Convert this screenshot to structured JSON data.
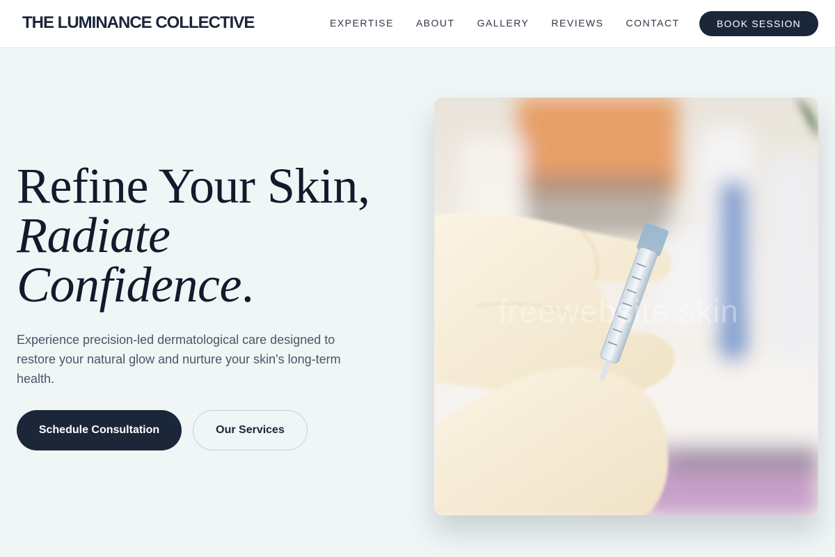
{
  "brand": {
    "name": "THE LUMINANCE COLLECTIVE"
  },
  "nav": {
    "items": [
      {
        "label": "EXPERTISE"
      },
      {
        "label": "ABOUT"
      },
      {
        "label": "GALLERY"
      },
      {
        "label": "REVIEWS"
      },
      {
        "label": "CONTACT"
      }
    ],
    "cta_label": "BOOK SESSION"
  },
  "hero": {
    "title_line1": "Refine Your Skin,",
    "title_line2": "Radiate",
    "title_line3_italic": "Confidence",
    "title_line3_end": ".",
    "description": "Experience precision-led dermatological care designed to restore your natural glow and nurture your skin's long-term health.",
    "primary_button": "Schedule Consultation",
    "secondary_button": "Our Services",
    "image_watermark": "freewebsite.skin"
  },
  "colors": {
    "primary": "#1c2639",
    "background": "#f0f6f6",
    "header_bg": "#ffffff",
    "text_muted": "#4a5567"
  },
  "icons": {
    "hero_image": "gloved-hands-syringe-photo"
  }
}
